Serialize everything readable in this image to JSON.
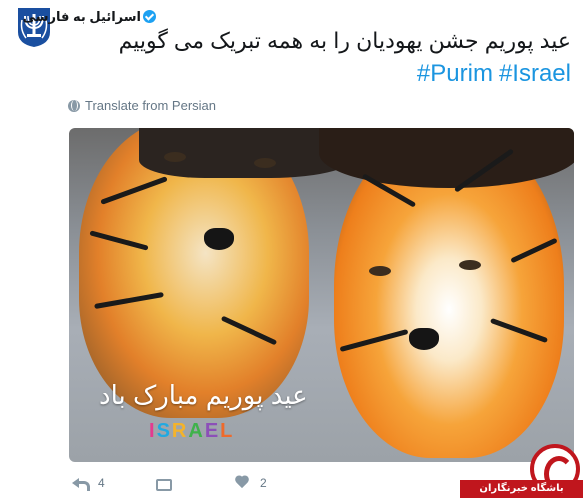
{
  "account": {
    "name": "اسرائیل به فارسی",
    "verified_icon": "verified-badge-icon",
    "avatar_icon": "state-emblem-icon"
  },
  "tweet": {
    "text": "عید پوریم جشن یهودیان را به همه تبریک می گوییم",
    "hashtags": [
      "#Purim",
      "#Israel"
    ],
    "translate_label": "Translate from Persian"
  },
  "media": {
    "caption": "عید پوریم مبارک باد",
    "logo_letters": [
      "I",
      "S",
      "R",
      "A",
      "E",
      "L"
    ]
  },
  "actions": {
    "reply_count": "4",
    "retweet_count": "",
    "like_count": "2"
  },
  "watermark": {
    "label": "باشگاه خبرنگاران"
  },
  "colors": {
    "accent": "#1da1f2",
    "hashtag": "#1b95e0",
    "muted": "#657786",
    "watermark": "#c0161d"
  }
}
